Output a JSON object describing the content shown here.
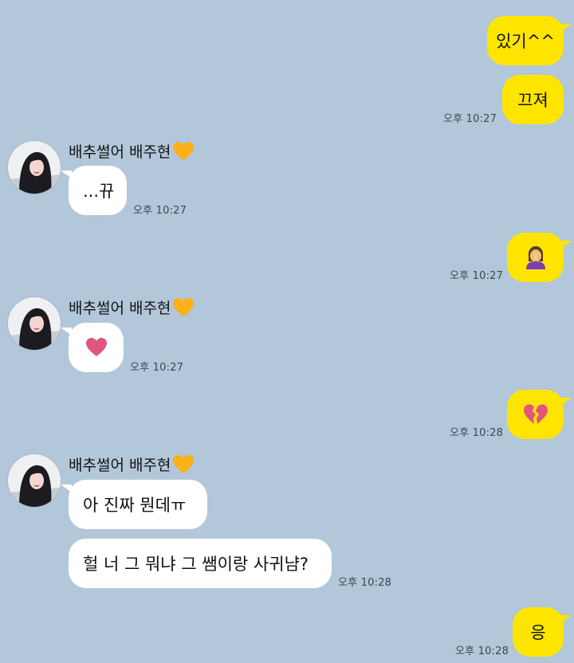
{
  "contact": {
    "name": "배추썰어 배주현"
  },
  "colors": {
    "background": "#b2c7d9",
    "my_bubble": "#fee500",
    "their_bubble": "#ffffff",
    "heart_name": "#fbb117",
    "heart_pink": "#e0567f",
    "raised_hand_purple": "#7b3fb3"
  },
  "messages": [
    {
      "sender": "me",
      "text": "있기^^"
    },
    {
      "sender": "me",
      "text": "끄져",
      "time": "오후 10:27"
    },
    {
      "sender": "them",
      "text": "...뀨",
      "time": "오후 10:27"
    },
    {
      "sender": "me",
      "icon": "woman-facepalming-icon",
      "time": "오후 10:27"
    },
    {
      "sender": "them",
      "icon": "pink-heart-icon",
      "time": "오후 10:27"
    },
    {
      "sender": "me",
      "icon": "broken-heart-icon",
      "time": "오후 10:28"
    },
    {
      "sender": "them",
      "text": "아 진짜 뭔데ㅠ"
    },
    {
      "sender": "them",
      "text": "헐 너 그 뭐냐 그 쌤이랑 사귀냠?",
      "time": "오후 10:28"
    },
    {
      "sender": "me",
      "text": "응",
      "time": "오후 10:28"
    }
  ]
}
